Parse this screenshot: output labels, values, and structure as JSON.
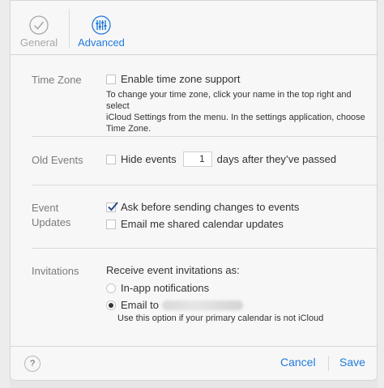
{
  "toolbar": {
    "tabs": [
      {
        "label": "General",
        "icon": "checkmark-circle-icon",
        "active": false
      },
      {
        "label": "Advanced",
        "icon": "sliders-icon",
        "active": true
      }
    ],
    "accent_color": "#1f7adf"
  },
  "time_zone": {
    "label": "Time Zone",
    "checkbox_label": "Enable time zone support",
    "checked": false,
    "help_line1": "To change your time zone, click your name in the top right and select",
    "help_line2": "iCloud Settings from the menu. In the settings application, choose",
    "help_line3": "Time Zone."
  },
  "old_events": {
    "label": "Old Events",
    "checkbox_label": "Hide events",
    "checked": false,
    "days_value": "1",
    "suffix": "days after they’ve passed"
  },
  "event_updates": {
    "label_line1": "Event",
    "label_line2": "Updates",
    "option1": {
      "label": "Ask before sending changes to events",
      "checked": true
    },
    "option2": {
      "label": "Email me shared calendar updates",
      "checked": false
    }
  },
  "invitations": {
    "label": "Invitations",
    "prompt": "Receive event invitations as:",
    "option1": {
      "label": "In-app notifications",
      "selected": false
    },
    "option2": {
      "label": "Email to",
      "selected": true
    },
    "note": "Use this option if your primary calendar is not iCloud"
  },
  "footer": {
    "help": "?",
    "cancel": "Cancel",
    "save": "Save"
  }
}
